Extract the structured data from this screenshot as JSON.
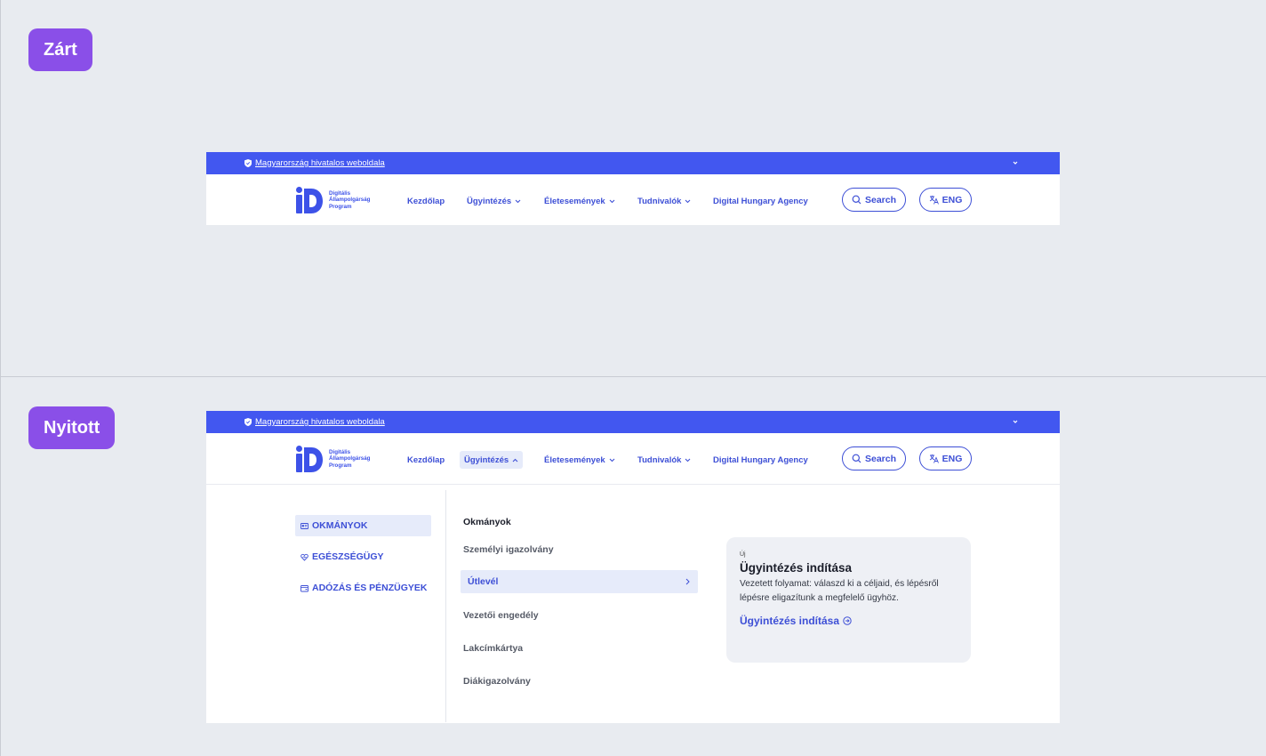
{
  "states": {
    "closed_label": "Zárt",
    "open_label": "Nyitott"
  },
  "topbar": {
    "official_text": "Magyarország hivatalos weboldala",
    "icons": [
      "shield-icon",
      "chevron-down-icon"
    ]
  },
  "logo": {
    "line1": "Digitális",
    "line2": "Állampolgárság",
    "line3": "Program"
  },
  "nav": {
    "items": [
      {
        "label": "Kezdőlap"
      },
      {
        "label": "Ügyintézés"
      },
      {
        "label": "Életesemények"
      },
      {
        "label": "Tudnivalók"
      },
      {
        "label": "Digital Hungary Agency"
      }
    ],
    "search_label": "Search",
    "lang_label": "ENG"
  },
  "menu": {
    "categories": [
      {
        "label": "OKMÁNYOK",
        "icon": "id-card-icon"
      },
      {
        "label": "EGÉSZSÉGÜGY",
        "icon": "heart-icon"
      },
      {
        "label": "ADÓZÁS ÉS PÉNZÜGYEK",
        "icon": "wallet-icon"
      }
    ],
    "subheading": "Okmányok",
    "items": [
      {
        "label": "Személyi igazolvány"
      },
      {
        "label": "Útlevél"
      },
      {
        "label": "Vezetői engedély"
      },
      {
        "label": "Lakcímkártya"
      },
      {
        "label": "Diákigazolvány"
      }
    ]
  },
  "card": {
    "tag": "Új",
    "title": "Ügyintézés indítása",
    "description": "Vezetett folyamat: válaszd ki a céljaid, és lépésről lépésre eligazítunk a megfelelő ügyhöz.",
    "link_label": "Ügyintézés indítása"
  },
  "colors": {
    "brand_blue": "#4257f0",
    "badge_purple": "#8a4fe8",
    "link_blue": "#3d4fd6",
    "active_bg": "#e6ebfa"
  }
}
